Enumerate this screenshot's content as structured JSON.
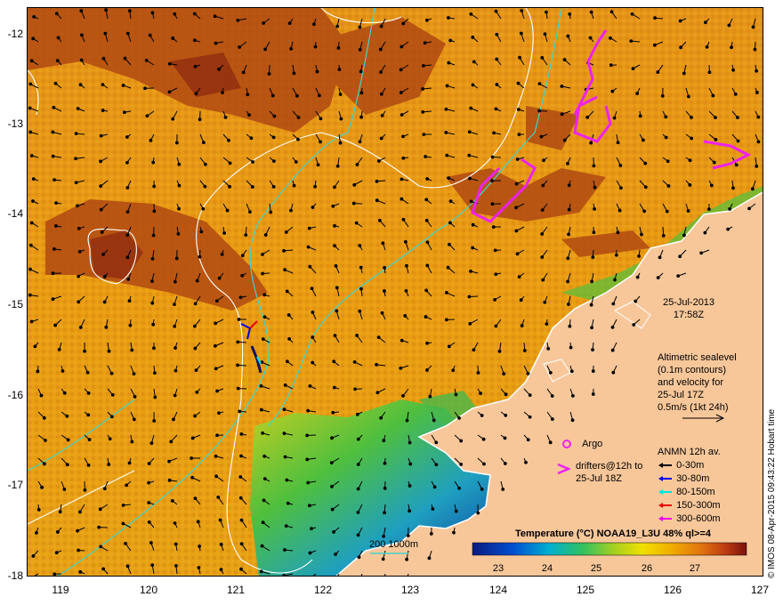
{
  "axes": {
    "lat_ticks": [
      "-12",
      "-13",
      "-14",
      "-15",
      "-16",
      "-17",
      "-18"
    ],
    "lon_ticks": [
      "119",
      "120",
      "121",
      "122",
      "123",
      "124",
      "125",
      "126",
      "127"
    ]
  },
  "map": {
    "land_color": "#f7c79a",
    "sea_warm_color": "#e89a10",
    "sea_hot_color": "#b44a10",
    "coast_line_color": "#ffffff",
    "isobath_color": "#45d3c8",
    "contour_color": "#ffffff",
    "vector_color": "#000000"
  },
  "date_label": {
    "date": "25-Jul-2013",
    "time": "17:58Z"
  },
  "altimetry_note": {
    "lines": [
      "Altimetric sealevel",
      "(0.1m contours)",
      "and velocity for",
      "25-Jul 17Z",
      "0.5m/s (1kt 24h)"
    ]
  },
  "argo_legend": {
    "label": "Argo"
  },
  "drifters_legend": {
    "lines": [
      "drifters@12h to",
      "25-Jul 18Z"
    ]
  },
  "anmn_legend": {
    "title": "ANMN 12h av.",
    "items": [
      {
        "label": "0-30m",
        "color": "#000000"
      },
      {
        "label": "30-80m",
        "color": "#0000ee"
      },
      {
        "label": "80-150m",
        "color": "#00e5e5"
      },
      {
        "label": "150-300m",
        "color": "#ee0000"
      },
      {
        "label": "300-600m",
        "color": "#ee00ee"
      }
    ]
  },
  "isobath_legend": {
    "label": "200  1000m"
  },
  "colorbar": {
    "title": "Temperature (°C) NOAA19_L3U 48% ql>=4",
    "ticks": [
      "23",
      "24",
      "25",
      "26",
      "27"
    ]
  },
  "credit": "© IMOS 08-Apr-2015 09:43:22 Hobart time"
}
